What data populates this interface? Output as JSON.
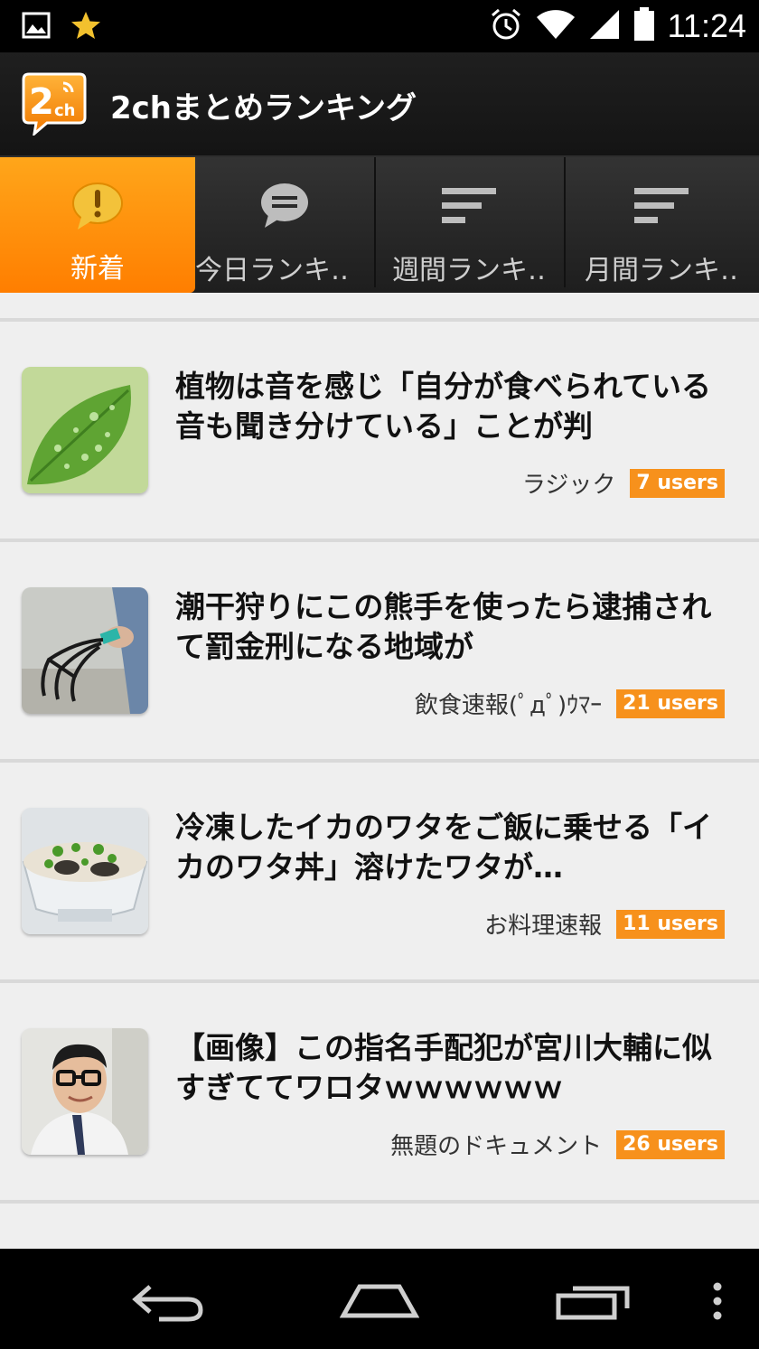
{
  "status_bar": {
    "time": "11:24",
    "icons": [
      "image-icon",
      "star-icon",
      "alarm-icon",
      "wifi-icon",
      "signal-icon",
      "battery-icon"
    ]
  },
  "app": {
    "title": "2chまとめランキング",
    "logo_text": "2ch",
    "accent_color": "#ff8c00"
  },
  "tabs": [
    {
      "label": "新着",
      "icon": "alert-bubble-icon",
      "active": true
    },
    {
      "label": "今日ランキ‥",
      "icon": "chat-bubble-icon",
      "active": false
    },
    {
      "label": "週間ランキ‥",
      "icon": "sort-lines-icon",
      "active": false
    },
    {
      "label": "月間ランキ‥",
      "icon": "sort-lines-icon",
      "active": false
    }
  ],
  "articles": [
    {
      "title": "植物は音を感じ「自分が食べられている音も聞き分けている」ことが判",
      "source": "ラジック",
      "users": "7 users",
      "thumb": "leaf-with-water-drops"
    },
    {
      "title": "潮干狩りにこの熊手を使ったら逮捕されて罰金刑になる地域が",
      "source": "飲食速報(ﾟдﾟ)ｳﾏｰ",
      "users": "21 users",
      "thumb": "clam-rake-in-hand"
    },
    {
      "title": "冷凍したイカのワタをご飯に乗せる「イカのワタ丼」溶けたワタが…",
      "source": "お料理速報",
      "users": "11 users",
      "thumb": "rice-bowl-with-squid"
    },
    {
      "title": "【画像】この指名手配犯が宮川大輔に似すぎててワロタｗｗｗｗｗｗ",
      "source": "無題のドキュメント",
      "users": "26 users",
      "thumb": "man-with-glasses"
    }
  ],
  "nav_bar": [
    "back-icon",
    "home-icon",
    "recents-icon",
    "overflow-menu-icon"
  ]
}
